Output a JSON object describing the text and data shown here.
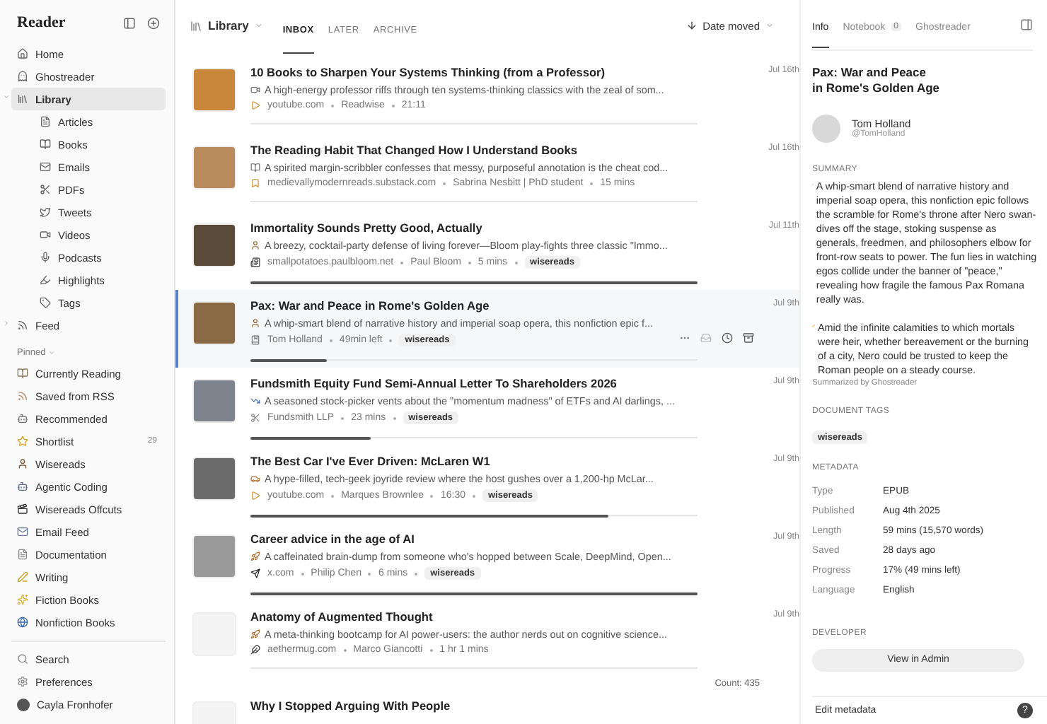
{
  "sidebar": {
    "title": "Reader",
    "nav": [
      {
        "label": "Home",
        "selected": false
      },
      {
        "label": "Ghostreader",
        "selected": false
      },
      {
        "label": "Library",
        "selected": true,
        "expanded": true,
        "children": [
          {
            "label": "Articles",
            "selected": false
          },
          {
            "label": "Books",
            "selected": false
          },
          {
            "label": "Emails",
            "selected": false
          },
          {
            "label": "PDFs",
            "selected": false
          },
          {
            "label": "Tweets",
            "selected": false
          },
          {
            "label": "Videos",
            "selected": false
          },
          {
            "label": "Podcasts",
            "selected": false
          },
          {
            "label": "Highlights",
            "selected": false
          },
          {
            "label": "Tags",
            "selected": false
          }
        ]
      },
      {
        "label": "Feed",
        "selected": false,
        "expanded": false
      }
    ],
    "pinned_title": "Pinned",
    "pinned": [
      {
        "label": "Currently Reading",
        "selected": false
      },
      {
        "label": "Saved from RSS",
        "selected": false
      },
      {
        "label": "Recommended",
        "selected": false
      },
      {
        "label": "Shortlist",
        "selected": false,
        "count": "29"
      },
      {
        "label": "Wisereads",
        "selected": false
      },
      {
        "label": "Agentic Coding",
        "selected": false
      },
      {
        "label": "Wisereads Offcuts",
        "selected": false
      },
      {
        "label": "Email Feed",
        "selected": false
      },
      {
        "label": "Documentation",
        "selected": false
      },
      {
        "label": "Writing",
        "selected": false
      },
      {
        "label": "Fiction Books",
        "selected": false
      },
      {
        "label": "Nonfiction Books",
        "selected": false
      }
    ],
    "footer": [
      {
        "label": "Search"
      },
      {
        "label": "Preferences"
      }
    ],
    "user": {
      "name": "Cayla Fronhofer"
    }
  },
  "list": {
    "title": "Library",
    "tabs": [
      {
        "label": "INBOX",
        "selected": true
      },
      {
        "label": "LATER",
        "selected": false
      },
      {
        "label": "ARCHIVE",
        "selected": false
      }
    ],
    "sort": "Date moved",
    "rows": [
      {
        "title": "10 Books to Sharpen Your Systems Thinking (from a Professor)",
        "summary": "A high-energy professor riffs through ten systems-thinking classics with the zeal of som...",
        "domain": "youtube.com",
        "author": "Readwise",
        "duration": "21:11",
        "date": "Jul 16th",
        "selected": false
      },
      {
        "title": "The Reading Habit That Changed How I Understand Books",
        "summary": "A spirited margin-scribbler confesses that messy, purposeful annotation is the cheat cod...",
        "domain": "medievallymodernreads.substack.com",
        "author": "Sabrina Nesbitt | PhD student",
        "duration": "15 mins",
        "date": "Jul 16th",
        "selected": false
      },
      {
        "title": "Immortality Sounds Pretty Good, Actually",
        "summary": "A breezy, cocktail-party defense of living forever—Bloom play-fights three classic \"Immo...",
        "domain": "smallpotatoes.paulbloom.net",
        "author": "Paul Bloom",
        "duration": "5 mins",
        "tag": "wisereads",
        "date": "Jul 11th",
        "selected": false,
        "level": 1
      },
      {
        "title": "Pax: War and Peace in Rome's Golden Age",
        "summary": "A whip-smart blend of narrative history and imperial soap opera, this nonfiction epic f...",
        "author": "Tom Holland",
        "duration": "49min left",
        "tag": "wisereads",
        "date": "Jul 9th",
        "selected": true,
        "level": 0.17
      },
      {
        "title": "Fundsmith Equity Fund Semi-Annual Letter To Shareholders 2026",
        "summary": "A seasoned stock-picker vents about the \"momentum madness\" of ETFs and AI darlings, ...",
        "author": "Fundsmith LLP",
        "duration": "23 mins",
        "tag": "wisereads",
        "date": "Jul 9th",
        "selected": false,
        "level": 0.27
      },
      {
        "title": "The Best Car I've Ever Driven: McLaren W1",
        "summary": "A hype-filled, tech-geek joyride review where the host gushes over a 1,200-hp McLar...",
        "domain": "youtube.com",
        "author": "Marques Brownlee",
        "duration": "16:30",
        "tag": "wisereads",
        "date": "Jul 9th",
        "selected": false,
        "level": 0.8
      },
      {
        "title": "Career advice in the age of AI",
        "summary": "A caffeinated brain-dump from someone who's hopped between Scale, DeepMind, Open...",
        "domain": "x.com",
        "author": "Philip Chen",
        "duration": "6 mins",
        "tag": "wisereads",
        "date": "Jul 9th",
        "selected": false,
        "level": 1
      },
      {
        "title": "Anatomy of Augmented Thought",
        "summary": "A meta-thinking bootcamp for AI power-users: the author nerds out on cognitive science...",
        "domain": "aethermug.com",
        "author": "Marco Giancotti",
        "duration": "1 hr 1 mins",
        "date": "Jul 9th",
        "selected": false
      },
      {
        "title": "Why I Stopped Arguing With People",
        "selected": false
      }
    ],
    "count": "Count: 435"
  },
  "details": {
    "tabs": [
      {
        "label": "Info",
        "selected": true
      },
      {
        "label": "Notebook",
        "selected": false,
        "count": "0"
      },
      {
        "label": "Ghostreader",
        "selected": false
      }
    ],
    "title": "Pax: War and Peace\nin Rome's Golden Age",
    "author": "Tom Holland",
    "handle": "@TomHolland",
    "summary_label": "SUMMARY",
    "summary": [
      "A whip-smart blend of narrative history and imperial soap opera, this nonfiction epic follows the scramble for Rome's throne after Nero swan-dives off the stage, stoking suspense as generals, freedmen, and philosophers elbow for front-row seats to power. The fun lies in watching egos collide under the banner of \"peace,\" revealing how fragile the famous Pax Romana really was.",
      "Amid the infinite calamities to which mortals were heir, whether bereavement or the burning of a city, Nero could be trusted to keep the Roman people on a steady course."
    ],
    "summary_credit": "Summarized by Ghostreader",
    "tags_label": "DOCUMENT TAGS",
    "tags": [
      "wisereads"
    ],
    "metadata_label": "METADATA",
    "metadata": [
      {
        "key": "Type",
        "value": "EPUB"
      },
      {
        "key": "Published",
        "value": "Aug 4th 2025"
      },
      {
        "key": "Length",
        "value": "59 mins (15,570 words)"
      },
      {
        "key": "Saved",
        "value": "28 days ago"
      },
      {
        "key": "Progress",
        "value": "17% (49 mins left)"
      },
      {
        "key": "Language",
        "value": "English"
      }
    ],
    "developer_label": "DEVELOPER",
    "admin_button": "View in Admin",
    "edit": "Edit metadata",
    "help": "?"
  }
}
